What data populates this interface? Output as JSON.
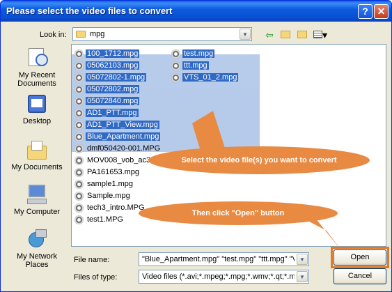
{
  "window": {
    "title": "Please select the video files to convert"
  },
  "look_in": {
    "label": "Look in:",
    "value": "mpg"
  },
  "toolbar": {
    "back_icon": "back-icon",
    "up_icon": "up-folder-icon",
    "new_folder_icon": "new-folder-icon",
    "views_icon": "views-menu-icon"
  },
  "places": [
    {
      "label": "My Recent Documents",
      "icon": "recent-documents-icon"
    },
    {
      "label": "Desktop",
      "icon": "desktop-icon"
    },
    {
      "label": "My Documents",
      "icon": "my-documents-icon"
    },
    {
      "label": "My Computer",
      "icon": "my-computer-icon"
    },
    {
      "label": "My Network Places",
      "icon": "network-places-icon"
    }
  ],
  "files_col1": [
    {
      "name": "100_1712.mpg",
      "selected": true
    },
    {
      "name": "05062103.mpg",
      "selected": true
    },
    {
      "name": "05072802-1.mpg",
      "selected": true
    },
    {
      "name": "05072802.mpg",
      "selected": true
    },
    {
      "name": "05072840.mpg",
      "selected": true
    },
    {
      "name": "AD1_PTT.mpg",
      "selected": true
    },
    {
      "name": "AD1_PTT_View.mpg",
      "selected": true
    },
    {
      "name": "Blue_Apartment.mpg",
      "selected": true
    },
    {
      "name": "dmf050420-001.MPG",
      "selected": false
    },
    {
      "name": "MOV008_vob_ac3.mpg",
      "selected": false
    },
    {
      "name": "PA161653.mpg",
      "selected": false
    },
    {
      "name": "sample1.mpg",
      "selected": false
    },
    {
      "name": "Sample.mpg",
      "selected": false
    },
    {
      "name": "tech3_intro.MPG",
      "selected": false
    },
    {
      "name": "test1.MPG",
      "selected": false
    }
  ],
  "files_col2": [
    {
      "name": "test.mpg",
      "selected": true
    },
    {
      "name": "ttt.mpg",
      "selected": true
    },
    {
      "name": "VTS_01_2.mpg",
      "selected": true
    }
  ],
  "callouts": {
    "select": "Select the video file(s) you want to convert",
    "open": "Then click \"Open\" button"
  },
  "file_name": {
    "label": "File name:",
    "value": "\"Blue_Apartment.mpg\" \"test.mpg\" \"ttt.mpg\" \"V"
  },
  "file_type": {
    "label": "Files of type:",
    "value": "Video files (*.avi;*.mpeg;*.mpg;*.wmv;*.qt;*.mpm"
  },
  "buttons": {
    "open": "Open",
    "cancel": "Cancel"
  },
  "colors": {
    "accent": "#316ac5",
    "callout": "#e88a42",
    "titlebar": "#0a4fd2"
  }
}
